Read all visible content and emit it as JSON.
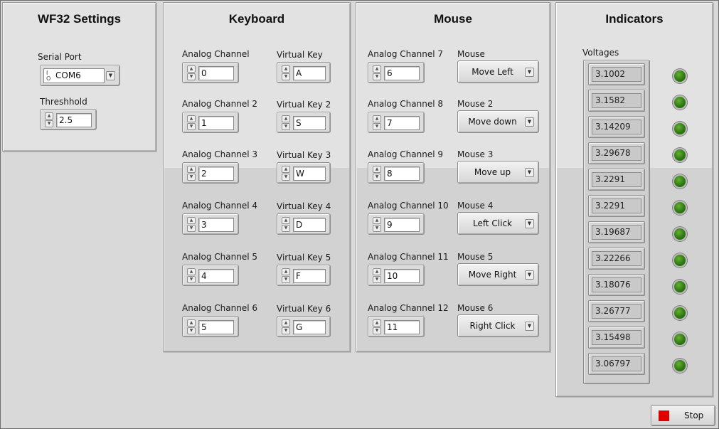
{
  "wf32": {
    "title": "WF32 Settings",
    "serial_port_label": "Serial Port",
    "serial_port_io_top": "I",
    "serial_port_io_bottom": "O",
    "serial_port_value": "COM6",
    "threshold_label": "Threshhold",
    "threshold_value": "2.5"
  },
  "keyboard": {
    "title": "Keyboard",
    "channels": [
      {
        "label": "Analog Channel",
        "value": "0"
      },
      {
        "label": "Analog Channel 2",
        "value": "1"
      },
      {
        "label": "Analog Channel 3",
        "value": "2"
      },
      {
        "label": "Analog Channel 4",
        "value": "3"
      },
      {
        "label": "Analog Channel 5",
        "value": "4"
      },
      {
        "label": "Analog Channel 6",
        "value": "5"
      }
    ],
    "keys": [
      {
        "label": "Virtual Key",
        "value": "A"
      },
      {
        "label": "Virtual Key 2",
        "value": "S"
      },
      {
        "label": "Virtual Key 3",
        "value": "W"
      },
      {
        "label": "Virtual Key 4",
        "value": "D"
      },
      {
        "label": "Virtual Key 5",
        "value": "F"
      },
      {
        "label": "Virtual Key 6",
        "value": "G"
      }
    ]
  },
  "mouse": {
    "title": "Mouse",
    "channels": [
      {
        "label": "Analog Channel 7",
        "value": "6"
      },
      {
        "label": "Analog Channel 8",
        "value": "7"
      },
      {
        "label": "Analog Channel 9",
        "value": "8"
      },
      {
        "label": "Analog Channel 10",
        "value": "9"
      },
      {
        "label": "Analog Channel 11",
        "value": "10"
      },
      {
        "label": "Analog Channel 12",
        "value": "11"
      }
    ],
    "actions": [
      {
        "label": "Mouse",
        "value": "Move Left"
      },
      {
        "label": "Mouse 2",
        "value": "Move down"
      },
      {
        "label": "Mouse 3",
        "value": "Move up"
      },
      {
        "label": "Mouse 4",
        "value": "Left Click"
      },
      {
        "label": "Mouse 5",
        "value": "Move Right"
      },
      {
        "label": "Mouse 6",
        "value": "Right Click"
      }
    ]
  },
  "indicators": {
    "title": "Indicators",
    "voltages_label": "Voltages",
    "voltages": [
      "3.1002",
      "3.1582",
      "3.14209",
      "3.29678",
      "3.2291",
      "3.2291",
      "3.19687",
      "3.22266",
      "3.18076",
      "3.26777",
      "3.15498",
      "3.06797"
    ],
    "led_color": "#3a8a15"
  },
  "stop_button": {
    "label": "Stop",
    "color": "#e00000"
  },
  "icons": {
    "spin_up": "▲",
    "spin_down": "▼",
    "dropdown": "▼"
  }
}
